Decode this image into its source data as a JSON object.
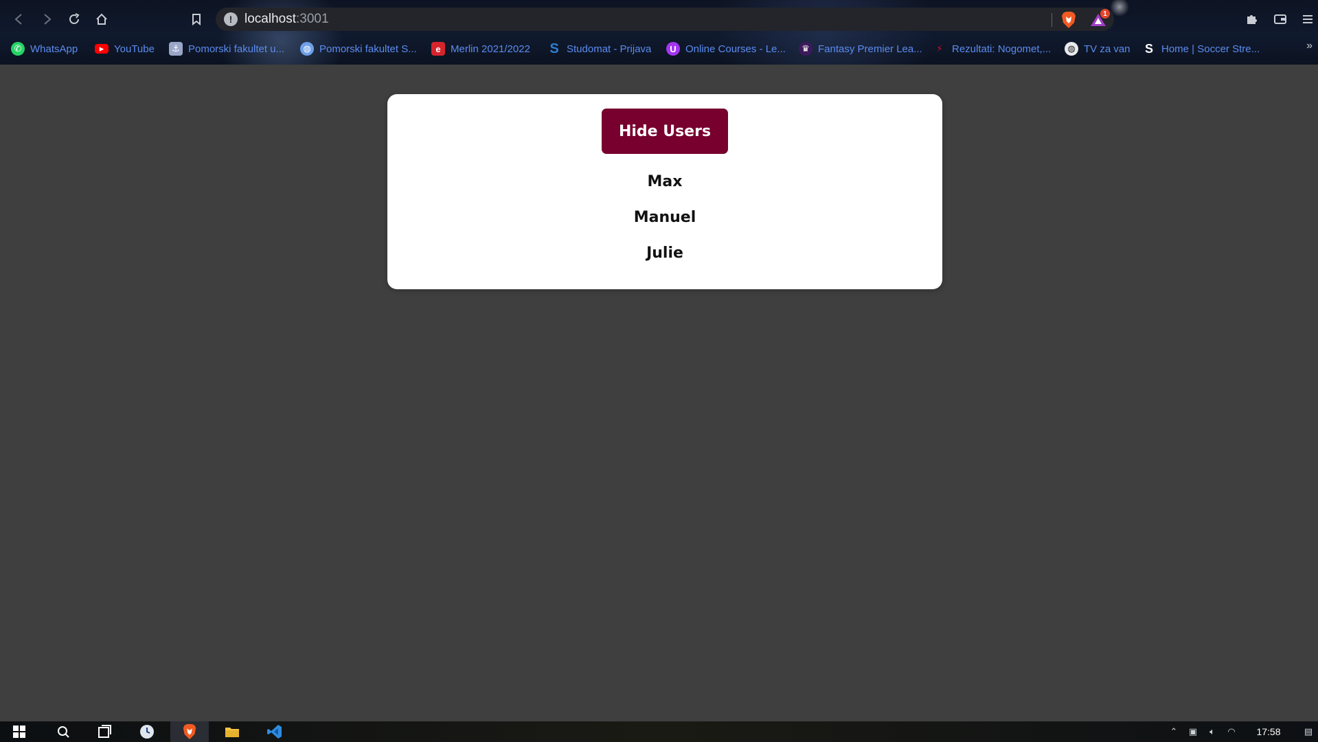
{
  "browser": {
    "url_host": "localhost",
    "url_port": ":3001",
    "rewards_badge": "1",
    "bookmarks": [
      {
        "label": "WhatsApp",
        "icon": "whatsapp-icon",
        "color": "#25d366"
      },
      {
        "label": "YouTube",
        "icon": "youtube-icon",
        "color": "#ff0000"
      },
      {
        "label": "Pomorski fakultet u...",
        "icon": "pomorski-icon",
        "color": "#9aa6c8"
      },
      {
        "label": "Pomorski fakultet S...",
        "icon": "globe-icon",
        "color": "#6fa0e8"
      },
      {
        "label": "Merlin 2021/2022",
        "icon": "merlin-icon",
        "color": "#d6242d"
      },
      {
        "label": "Studomat - Prijava",
        "icon": "studomat-icon",
        "color": "#2d7fd3"
      },
      {
        "label": "Online Courses - Le...",
        "icon": "udemy-icon",
        "color": "#a435f0"
      },
      {
        "label": "Fantasy Premier Lea...",
        "icon": "premier-league-icon",
        "color": "#3d195b"
      },
      {
        "label": "Rezultati: Nogomet,...",
        "icon": "flashscore-icon",
        "color": "#c8102e"
      },
      {
        "label": "TV za van",
        "icon": "globe-icon",
        "color": "#e8eaed"
      },
      {
        "label": "Home | Soccer Stre...",
        "icon": "soccer-streams-icon",
        "color": "#ffffff"
      }
    ],
    "bookmarks_more": "»"
  },
  "page": {
    "toggle_button_label": "Hide Users",
    "users": [
      "Max",
      "Manuel",
      "Julie"
    ],
    "button_color": "#77002e"
  },
  "taskbar": {
    "clock": "17:58"
  }
}
